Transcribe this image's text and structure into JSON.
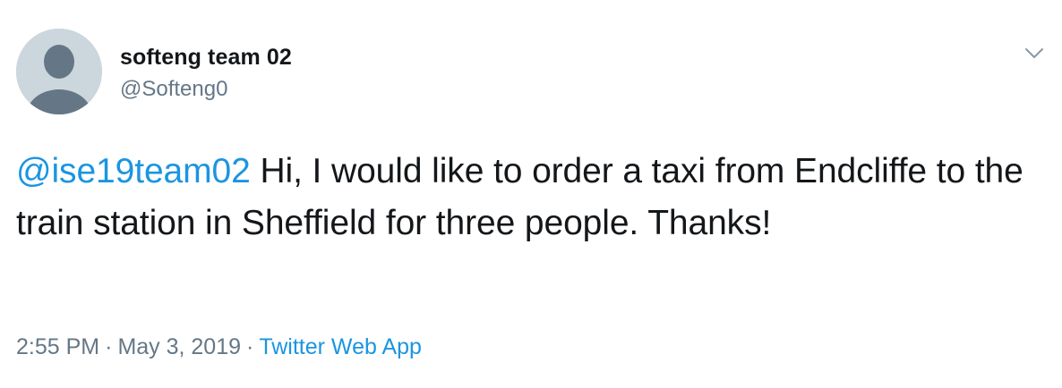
{
  "tweet": {
    "author": {
      "display_name": "softeng team 02",
      "handle": "@Softeng0",
      "avatar_icon": "default-profile-icon"
    },
    "menu_icon": "chevron-down-icon",
    "mention": "@ise19team02",
    "text": " Hi, I would like to order a taxi from Endcliffe to the train station in Sheffield for three people. Thanks!",
    "time": "2:55 PM",
    "separator": "·",
    "date": "May 3, 2019",
    "source": "Twitter Web App"
  },
  "colors": {
    "link": "#1b95e0",
    "secondary_text": "#657786",
    "avatar_bg": "#ccd6dd",
    "avatar_fg": "#657786"
  }
}
